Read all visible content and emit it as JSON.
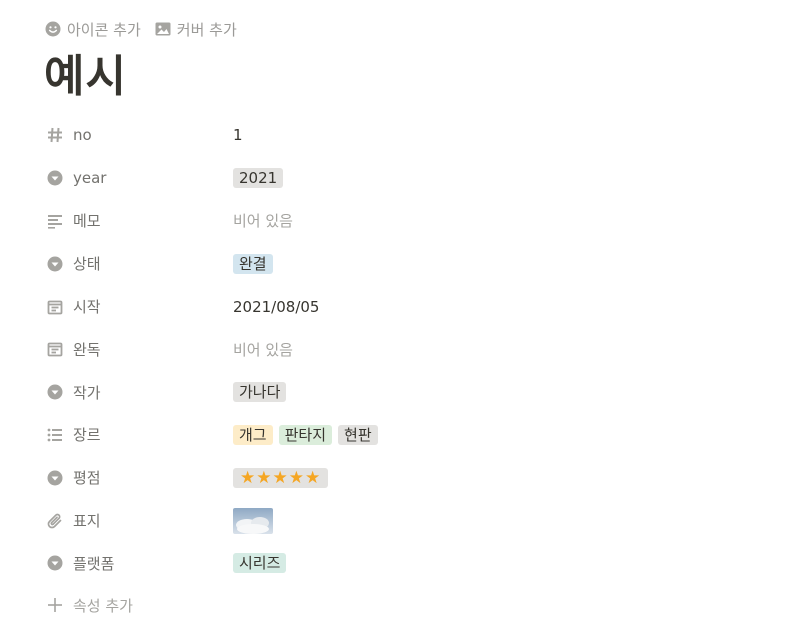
{
  "top_actions": {
    "add_icon_label": "아이콘 추가",
    "add_cover_label": "커버 추가"
  },
  "page": {
    "title": "예시"
  },
  "properties": {
    "no": {
      "name": "no",
      "value": "1"
    },
    "year": {
      "name": "year",
      "value": "2021"
    },
    "memo": {
      "name": "메모",
      "value": "비어 있음"
    },
    "status": {
      "name": "상태",
      "value": "완결"
    },
    "start": {
      "name": "시작",
      "value": "2021/08/05"
    },
    "finish": {
      "name": "완독",
      "value": "비어 있음"
    },
    "author": {
      "name": "작가",
      "value": "가나다"
    },
    "genre": {
      "name": "장르",
      "values": [
        "개그",
        "판타지",
        "현판"
      ]
    },
    "rating": {
      "name": "평점",
      "value": "★★★★★",
      "stars": 5
    },
    "cover": {
      "name": "표지"
    },
    "platform": {
      "name": "플랫폼",
      "value": "시리즈"
    }
  },
  "add_property_label": "속성 추가",
  "colors": {
    "text": "#37352f",
    "muted": "#9b9a97",
    "empty": "#a5a4a0",
    "tag_gray": "#e3e2e0",
    "tag_blue": "#d3e5ef",
    "tag_yellow": "#fdecc8",
    "tag_green": "#dbeddb",
    "tag_teal": "#d5ebe4",
    "star": "#f5a623"
  },
  "icons": {
    "no": "hash-icon",
    "year": "select-icon",
    "memo": "text-icon",
    "status": "select-icon",
    "start": "calendar-icon",
    "finish": "calendar-icon",
    "author": "select-icon",
    "genre": "multi-select-icon",
    "rating": "select-icon",
    "cover": "paperclip-icon",
    "platform": "select-icon",
    "add": "plus-icon"
  }
}
